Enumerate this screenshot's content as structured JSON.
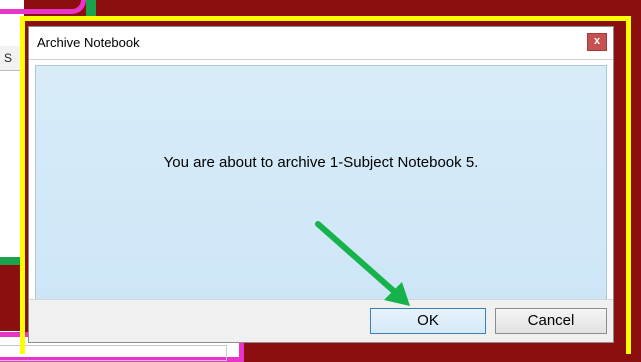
{
  "background": {
    "left_strip_text": "S"
  },
  "dialog": {
    "title": "Archive Notebook",
    "close_label": "x",
    "message": "You are about to archive 1-Subject Notebook 5.",
    "ok_label": "OK",
    "cancel_label": "Cancel"
  },
  "annotation": {
    "highlight_color": "#ffff00",
    "arrow_color": "#16b24a",
    "arrow_target": "ok-button"
  }
}
